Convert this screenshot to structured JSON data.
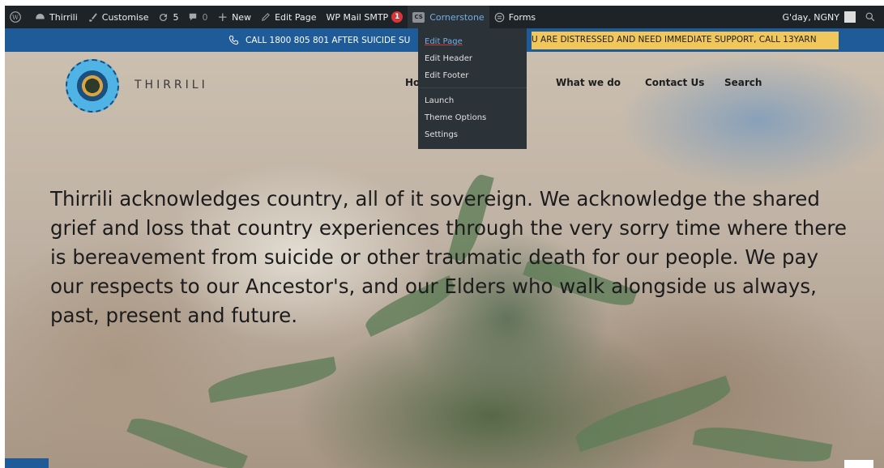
{
  "adminbar": {
    "site_name": "Thirrili",
    "customise": "Customise",
    "updates_count": "5",
    "comments_count": "0",
    "new_label": "New",
    "edit_page": "Edit Page",
    "wp_mail_smtp": "WP Mail SMTP",
    "smtp_badge": "1",
    "cornerstone_icon": "CS",
    "cornerstone": "Cornerstone",
    "forms": "Forms",
    "greeting": "G'day, NGNY",
    "colors": {
      "bar": "#1d2327",
      "accent": "#72aee6",
      "badge": "#d63638"
    }
  },
  "cornerstone_menu": {
    "items": [
      "Edit Page",
      "Edit Header",
      "Edit Footer",
      "Launch",
      "Theme Options",
      "Settings"
    ]
  },
  "notice": {
    "left_text": "CALL 1800 805 801 AFTER SUICIDE SU",
    "right_text": "U ARE DISTRESSED AND NEED IMMEDIATE SUPPORT, CALL 13YARN",
    "colors": {
      "bar": "#1f5b98",
      "highlight": "#f1c75b"
    }
  },
  "site": {
    "brand": "THIRRILI",
    "nav": [
      "Ho",
      "What we do",
      "Contact Us",
      "Search"
    ],
    "acknowledgement": "Thirrili acknowledges country, all of it sovereign. We acknowledge the shared grief and loss that country experiences through the very sorry time where there is bereavement from suicide or other traumatic death for our people. We pay our respects to our Ancestor's, and our Elders who walk alongside us always, past, present and future."
  }
}
